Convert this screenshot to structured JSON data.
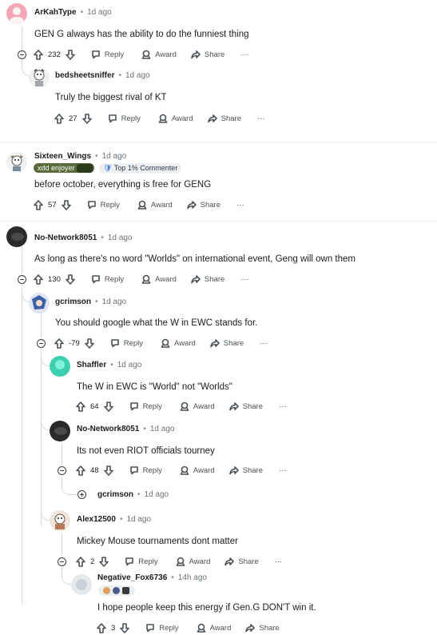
{
  "comments": [
    {
      "user": "ArKahType",
      "time": "1d ago",
      "text": "GEN G always has the ability to do the funniest thing",
      "score": "232"
    },
    {
      "user": "bedsheetsniffer",
      "time": "1d ago",
      "text": "Truly the biggest rival of KT",
      "score": "27"
    },
    {
      "user": "Sixteen_Wings",
      "time": "1d ago",
      "text": "before october, everything is free for GENG",
      "score": "57",
      "flair_user": "xdd enjoyer",
      "flair_badge": "Top 1% Commenter"
    },
    {
      "user": "No-Network8051",
      "time": "1d ago",
      "text": "As long as there's no word \"Worlds\" on international event, Geng will own them",
      "score": "130"
    },
    {
      "user": "gcrimson",
      "time": "1d ago",
      "text": "You should google what the W in EWC stands for.",
      "score": "-79"
    },
    {
      "user": "Shaffler",
      "time": "1d ago",
      "text": "The W in EWC is \"World\" not \"Worlds\"",
      "score": "64"
    },
    {
      "user": "No-Network8051",
      "time": "1d ago",
      "text": "Its not even RIOT officials tourney",
      "score": "48"
    },
    {
      "user": "gcrimson",
      "time": "1d ago"
    },
    {
      "user": "Alex12500",
      "time": "1d ago",
      "text": "Mickey Mouse tournaments dont matter",
      "score": "2"
    },
    {
      "user": "Negative_Fox6736",
      "time": "14h ago",
      "text": "I hope people keep this energy if Gen.G DON'T win it.",
      "score": "3"
    }
  ],
  "labels": {
    "reply": "Reply",
    "award": "Award",
    "share": "Share",
    "more": "···"
  }
}
